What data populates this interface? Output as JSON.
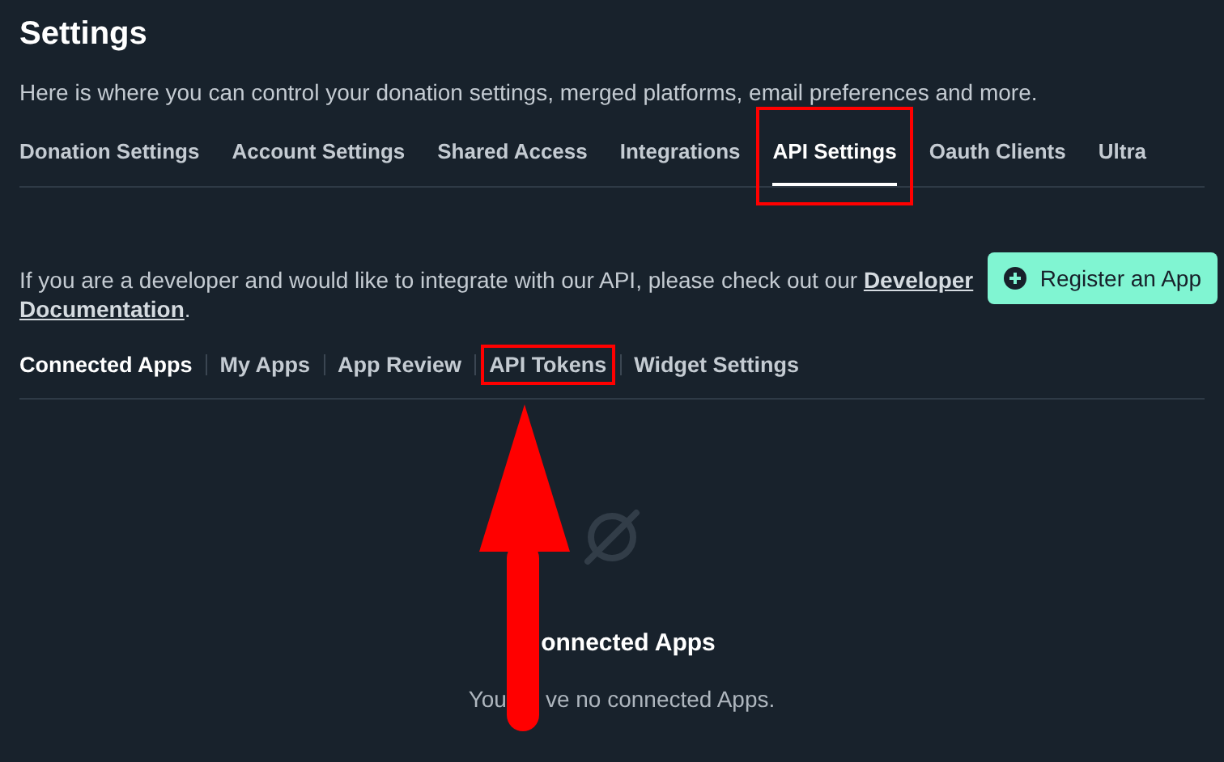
{
  "page": {
    "title": "Settings",
    "description": "Here is where you can control your donation settings, merged platforms, email preferences and more."
  },
  "tabs": [
    {
      "label": "Donation Settings",
      "selected": false,
      "annotated": false
    },
    {
      "label": "Account Settings",
      "selected": false,
      "annotated": false
    },
    {
      "label": "Shared Access",
      "selected": false,
      "annotated": false
    },
    {
      "label": "Integrations",
      "selected": false,
      "annotated": false
    },
    {
      "label": "API Settings",
      "selected": true,
      "annotated": true
    },
    {
      "label": "Oauth Clients",
      "selected": false,
      "annotated": false
    },
    {
      "label": "Ultra",
      "selected": false,
      "annotated": false
    }
  ],
  "intro": {
    "text": "If you are a developer and would like to integrate with our API, please check out our ",
    "link_parts": [
      "Developer",
      "Documentation"
    ],
    "end": "."
  },
  "register_button": {
    "label": "Register an App"
  },
  "subtabs": [
    {
      "label": "Connected Apps",
      "selected": true,
      "annotated": false
    },
    {
      "label": "My Apps",
      "selected": false,
      "annotated": false
    },
    {
      "label": "App Review",
      "selected": false,
      "annotated": false
    },
    {
      "label": "API Tokens",
      "selected": false,
      "annotated": true
    },
    {
      "label": "Widget Settings",
      "selected": false,
      "annotated": false
    }
  ],
  "empty_state": {
    "title": "onnected Apps",
    "message_start": "You",
    "message_end": "ve no connected Apps."
  },
  "annotation_arrow": {
    "shown": true
  }
}
